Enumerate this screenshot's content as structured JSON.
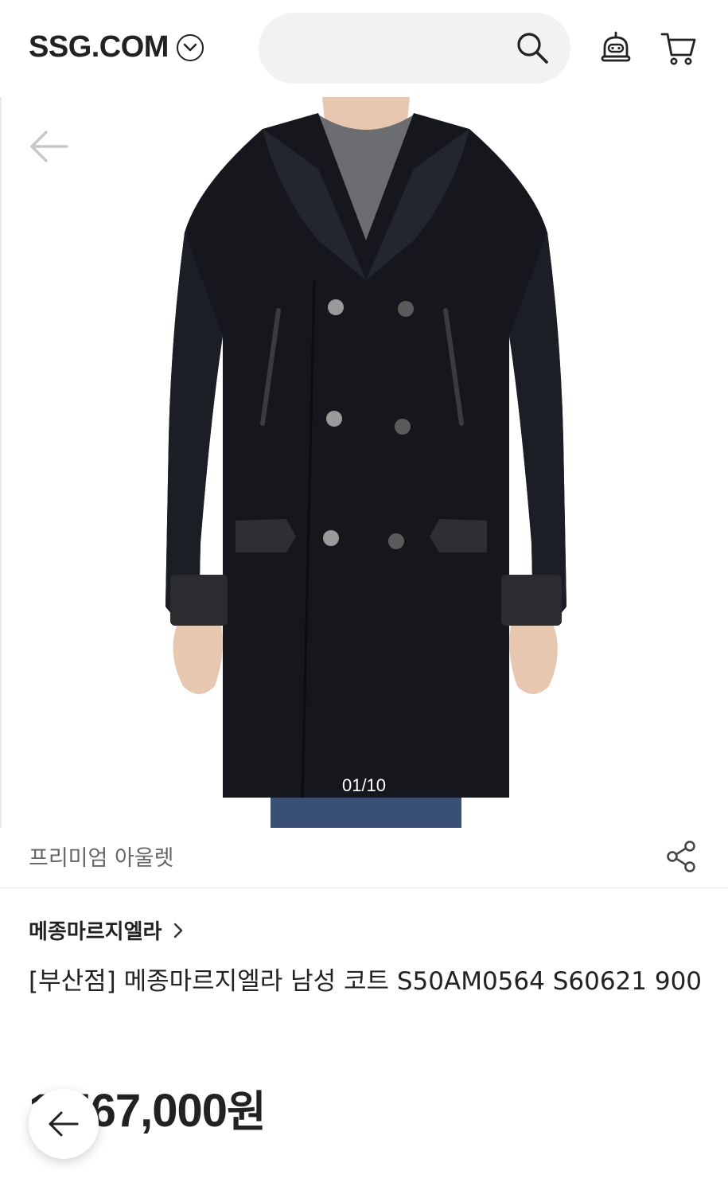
{
  "header": {
    "logo_text": "SSG.COM",
    "search_placeholder": "",
    "icons": [
      "search-icon",
      "chatbot-icon",
      "cart-icon"
    ]
  },
  "gallery": {
    "counter": "01/10",
    "icons": [
      "arrow-left-icon"
    ]
  },
  "store": {
    "name": "프리미엄 아울렛",
    "icons": [
      "share-icon"
    ]
  },
  "product": {
    "brand": "메종마르지엘라",
    "title": "[부산점] 메종마르지엘라 남성 코트 S50AM0564 S60621 900",
    "price_number": "1,567,000",
    "price_unit": "원"
  },
  "colors": {
    "search_bg": "#f2f2f2",
    "text": "#222222",
    "subtle_text": "#666666"
  }
}
